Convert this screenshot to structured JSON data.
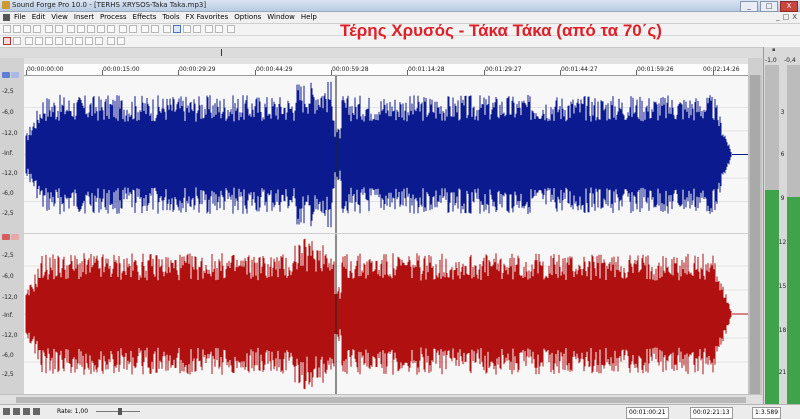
{
  "window": {
    "title": "Sound Forge Pro 10.0 - [TERHS XRYSOS-Taka Taka.mp3]",
    "controls": [
      "_",
      "□",
      "X"
    ]
  },
  "menu": {
    "items": [
      "File",
      "Edit",
      "View",
      "Insert",
      "Process",
      "Effects",
      "Tools",
      "FX Favorites",
      "Options",
      "Window",
      "Help"
    ],
    "mdi_controls": [
      "_",
      "□",
      "X"
    ]
  },
  "overlay": {
    "song_title": "Τέρης Χρυσός - Τάκα Τάκα (από τα 70΄ς)"
  },
  "ruler": {
    "labels": [
      "00:00:00:00",
      "00:00:15:00",
      "00:00:29:29",
      "00:00:44:29",
      "00:00:59:28",
      "00:01:14:28",
      "00:01:29:27",
      "00:01:44:27",
      "00:01:59:26",
      "00:02:14:26"
    ]
  },
  "channels": {
    "left": {
      "color": "#0b1a8f",
      "levels": [
        "-2,5",
        "-6,0",
        "-12,0",
        "-Inf.",
        "-12,0",
        "-6,0",
        "-2,5"
      ]
    },
    "right": {
      "color": "#b01010",
      "levels": [
        "-2,5",
        "-6,0",
        "-12,0",
        "-Inf.",
        "-12,0",
        "-6,0",
        "-2,5"
      ]
    }
  },
  "status": {
    "rate_label": "Rate: 1,00",
    "cursor_time": "00:01:00:21",
    "length": "00:02:21:13",
    "zoom": "1:3.589"
  },
  "meters": {
    "peak_left": "-1,0",
    "peak_right": "-0,4",
    "scale": [
      "3",
      "6",
      "9",
      "12",
      "15",
      "18",
      "21"
    ],
    "level_left": 0.63,
    "level_right": 0.61
  }
}
